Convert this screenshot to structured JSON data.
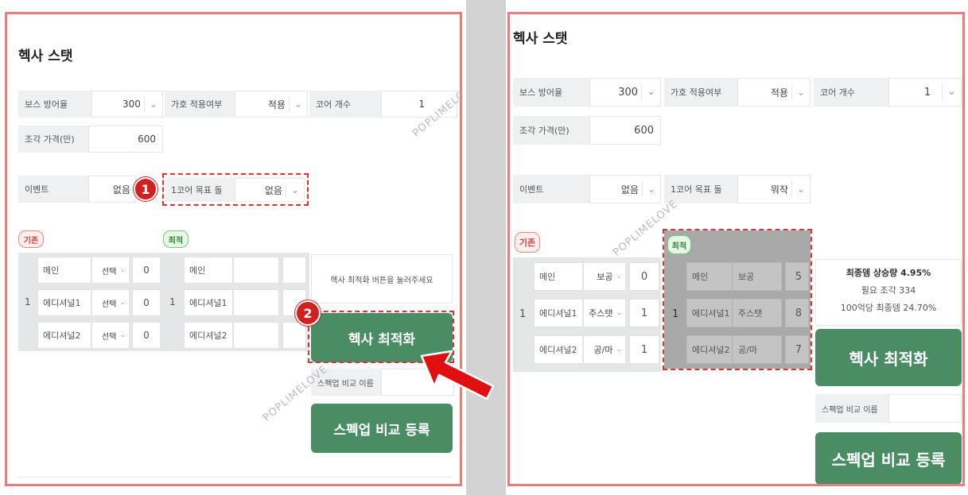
{
  "colors": {
    "panel_border": "#e37f7f",
    "button": "#4a8c64",
    "marker": "#d12020",
    "dash": "#dd3333",
    "divider": "#d3d3d3"
  },
  "watermark": "POPLIMELOVE",
  "markers": {
    "one": "1",
    "two": "2"
  },
  "left": {
    "title": "헥사 스탯",
    "boss_def": {
      "label": "보스 방어율",
      "value": "300"
    },
    "apply": {
      "label": "가호 적용여부",
      "value": "적용"
    },
    "core": {
      "label": "코어 개수",
      "value": "1"
    },
    "price": {
      "label": "조각 가격(만)",
      "value": "600"
    },
    "event": {
      "label": "이벤트",
      "value": "없음"
    },
    "goal": {
      "label": "1코어 목표 돌",
      "value": "없음"
    },
    "basic_tag": "기존",
    "opt_tag": "최적",
    "row_no": "1",
    "basic_rows": [
      {
        "name": "메인",
        "sel": "선택",
        "num": "0"
      },
      {
        "name": "에디셔널1",
        "sel": "선택",
        "num": "0"
      },
      {
        "name": "에디셔널2",
        "sel": "선택",
        "num": "0"
      }
    ],
    "opt_rows": [
      {
        "name": "메인"
      },
      {
        "name": "에디셔널1"
      },
      {
        "name": "에디셔널2"
      }
    ],
    "hint": "헥사 최적화 버튼을 눌러주세요",
    "optimize_btn": "헥사 최적화",
    "compare_label": "스펙업 비교 이름",
    "register_btn": "스펙업 비교 등록"
  },
  "right": {
    "title": "헥사 스탯",
    "boss_def": {
      "label": "보스 방어율",
      "value": "300"
    },
    "apply": {
      "label": "가호 적용여부",
      "value": "적용"
    },
    "core": {
      "label": "코어 개수",
      "value": "1"
    },
    "price": {
      "label": "조각 가격(만)",
      "value": "600"
    },
    "event": {
      "label": "이벤트",
      "value": "없음"
    },
    "goal": {
      "label": "1코어 목표 돌",
      "value": "뭐작"
    },
    "basic_tag": "기존",
    "opt_tag": "최적",
    "row_no": "1",
    "basic_rows": [
      {
        "name": "메인",
        "sel": "보공",
        "num": "0"
      },
      {
        "name": "에디셔널1",
        "sel": "주스탯",
        "num": "1"
      },
      {
        "name": "에디셔널2",
        "sel": "공/마",
        "num": "1"
      }
    ],
    "opt_rows": [
      {
        "name": "메인",
        "stat": "보공",
        "num": "5"
      },
      {
        "name": "에디셔널1",
        "stat": "주스탯",
        "num": "8"
      },
      {
        "name": "에디셔널2",
        "stat": "공/마",
        "num": "7"
      }
    ],
    "result": {
      "line1": "최종뎀 상승량 4.95%",
      "line2": "필요 조각 334",
      "line3": "100억당 최종뎀 24.70%"
    },
    "optimize_btn": "헥사 최적화",
    "compare_label": "스펙업 비교 이름",
    "register_btn": "스펙업 비교 등록"
  }
}
